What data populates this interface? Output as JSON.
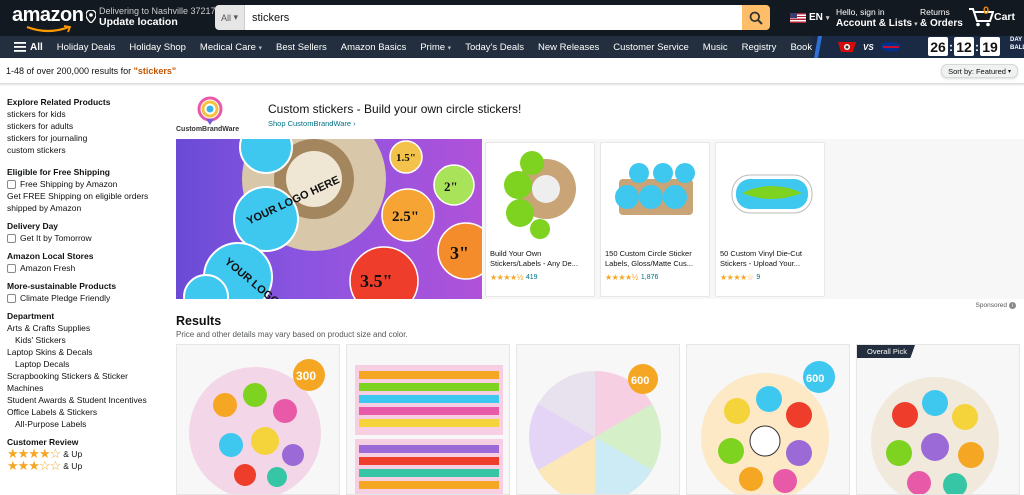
{
  "header": {
    "logo": "amazon",
    "deliver_line1": "Delivering to Nashville 37217",
    "deliver_line2": "Update location",
    "search_category": "All",
    "search_value": "stickers",
    "language": "EN",
    "account_line1": "Hello, sign in",
    "account_line2": "Account & Lists",
    "orders_line1": "Returns",
    "orders_line2": "& Orders",
    "cart_count": "0",
    "cart_label": "Cart"
  },
  "nav": {
    "all_label": "All",
    "items": [
      "Holiday Deals",
      "Holiday Shop",
      "Medical Care",
      "Best Sellers",
      "Amazon Basics",
      "Prime",
      "Today's Deals",
      "New Releases",
      "Customer Service",
      "Music",
      "Registry",
      "Books"
    ],
    "game": {
      "vs": "VS",
      "clock": [
        "26",
        "12",
        "19"
      ],
      "side_text": "DAY BALL"
    }
  },
  "results_bar": {
    "prefix": "1-48 of over 200,000 results for",
    "query": "\"stickers\"",
    "sort_label": "Sort by:",
    "sort_value": "Featured"
  },
  "sidebar": {
    "related_title": "Explore Related Products",
    "related": [
      "stickers for kids",
      "stickers for adults",
      "stickers for journaling",
      "custom stickers"
    ],
    "shipping_title": "Eligible for Free Shipping",
    "shipping_option": "Free Shipping by Amazon",
    "shipping_note": "Get FREE Shipping on eligible orders shipped by Amazon",
    "delivery_title": "Delivery Day",
    "delivery_option": "Get It by Tomorrow",
    "local_title": "Amazon Local Stores",
    "local_option": "Amazon Fresh",
    "sustainable_title": "More-sustainable Products",
    "sustainable_option": "Climate Pledge Friendly",
    "dept_title": "Department",
    "departments": [
      "Arts & Crafts Supplies",
      "Kids' Stickers",
      "Laptop Skins & Decals",
      "Laptop Decals",
      "Scrapbooking Stickers & Sticker Machines",
      "Student Awards & Student Incentives",
      "Office Labels & Stickers",
      "All-Purpose Labels"
    ],
    "review_title": "Customer Review",
    "review_up": "& Up"
  },
  "banner": {
    "brand_name": "CustomBrandWare",
    "title": "Custom stickers - Build your own circle stickers!",
    "link": "Shop CustomBrandWare ›",
    "hero_labels": [
      "YOUR LOGO HERE",
      "1.5\"",
      "2\"",
      "2.5\"",
      "3\"",
      "3.5\""
    ],
    "sponsored": "Sponsored",
    "products": [
      {
        "title": "Build Your Own Stickers/Labels - Any De...",
        "rating": 4.5,
        "reviews": "419"
      },
      {
        "title": "150 Custom Circle Sticker Labels, Gloss/Matte Cus...",
        "rating": 4.5,
        "reviews": "1,876"
      },
      {
        "title": "50 Custom Vinyl Die-Cut Stickers - Upload Your...",
        "rating": 4.0,
        "reviews": "9"
      }
    ]
  },
  "results": {
    "heading": "Results",
    "sub": "Price and other details may vary based on product size and color.",
    "badge": "Overall Pick",
    "cards": [
      {
        "count_tag": "300"
      },
      {
        "count_tag": ""
      },
      {
        "count_tag": "600"
      },
      {
        "count_tag": "600"
      },
      {
        "count_tag": ""
      }
    ]
  },
  "colors": {
    "nav_dark": "#131921",
    "nav_mid": "#232f3e",
    "search_button": "#febd69",
    "query_color": "#c45500",
    "link": "#007185",
    "star": "#f5a623"
  }
}
